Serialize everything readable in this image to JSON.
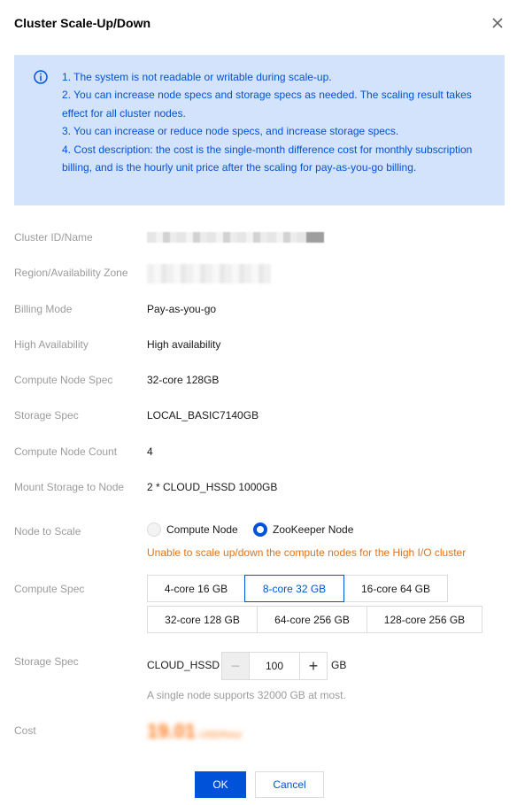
{
  "dialog": {
    "title": "Cluster Scale-Up/Down",
    "close_icon": "close-icon"
  },
  "notice": {
    "icon": "info-circle-icon",
    "lines": [
      "1. The system is not readable or writable during scale-up.",
      "2. You can increase node specs and storage specs as needed. The scaling result takes effect for all cluster nodes.",
      "3. You can increase or reduce node specs, and increase storage specs.",
      "4. Cost description: the cost is the single-month difference cost for monthly subscription billing, and is the hourly unit price after the scaling for pay-as-you-go billing."
    ]
  },
  "fields": {
    "cluster_id_label": "Cluster ID/Name",
    "region_label": "Region/Availability Zone",
    "billing_label": "Billing Mode",
    "billing_value": "Pay-as-you-go",
    "ha_label": "High Availability",
    "ha_value": "High availability",
    "compute_spec_label": "Compute Node Spec",
    "compute_spec_value": "32-core 128GB",
    "storage_spec_label": "Storage Spec",
    "storage_spec_value": "LOCAL_BASIC7140GB",
    "node_count_label": "Compute Node Count",
    "node_count_value": "4",
    "mount_label": "Mount Storage to Node",
    "mount_value": "2 * CLOUD_HSSD 1000GB"
  },
  "scale": {
    "node_label": "Node to Scale",
    "options": [
      "Compute Node",
      "ZooKeeper Node"
    ],
    "selected": "ZooKeeper Node",
    "warning": "Unable to scale up/down the compute nodes for the High I/O cluster"
  },
  "compute_spec": {
    "label": "Compute Spec",
    "options": [
      "4-core 16 GB",
      "8-core 32 GB",
      "16-core 64 GB",
      "32-core 128 GB",
      "64-core 256 GB",
      "128-core 256 GB"
    ],
    "selected": "8-core 32 GB"
  },
  "storage": {
    "label": "Storage Spec",
    "type": "CLOUD_HSSD",
    "value": "100",
    "minus": "−",
    "plus": "+",
    "unit": "GB",
    "hint": "A single node supports 32000 GB at most."
  },
  "cost": {
    "label": "Cost",
    "amount": "19.01",
    "suffix": "USD/hour"
  },
  "buttons": {
    "ok": "OK",
    "cancel": "Cancel"
  },
  "colors": {
    "primary": "#0052d9",
    "notice_bg": "#d4e3fc",
    "warning": "#e37318",
    "cost": "#ff7a1a"
  }
}
